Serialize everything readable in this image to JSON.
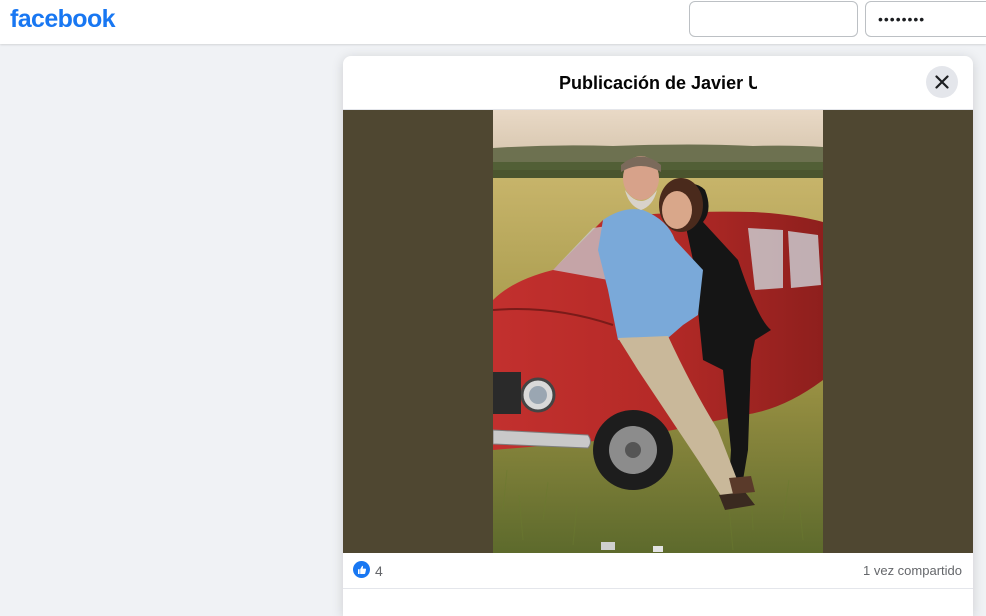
{
  "header": {
    "logo_text": "facebook",
    "email_value": "",
    "password_value": "••••••••"
  },
  "post_modal": {
    "title": "Publicación de Javier U",
    "photo": {
      "description_icon": "photo-couple-red-car"
    },
    "stats": {
      "like_count": "4",
      "shares_text": "1 vez compartido"
    }
  },
  "colors": {
    "brand_blue": "#1877f2",
    "page_bg": "#f0f2f5",
    "photo_letterbox": "#4f4731"
  }
}
